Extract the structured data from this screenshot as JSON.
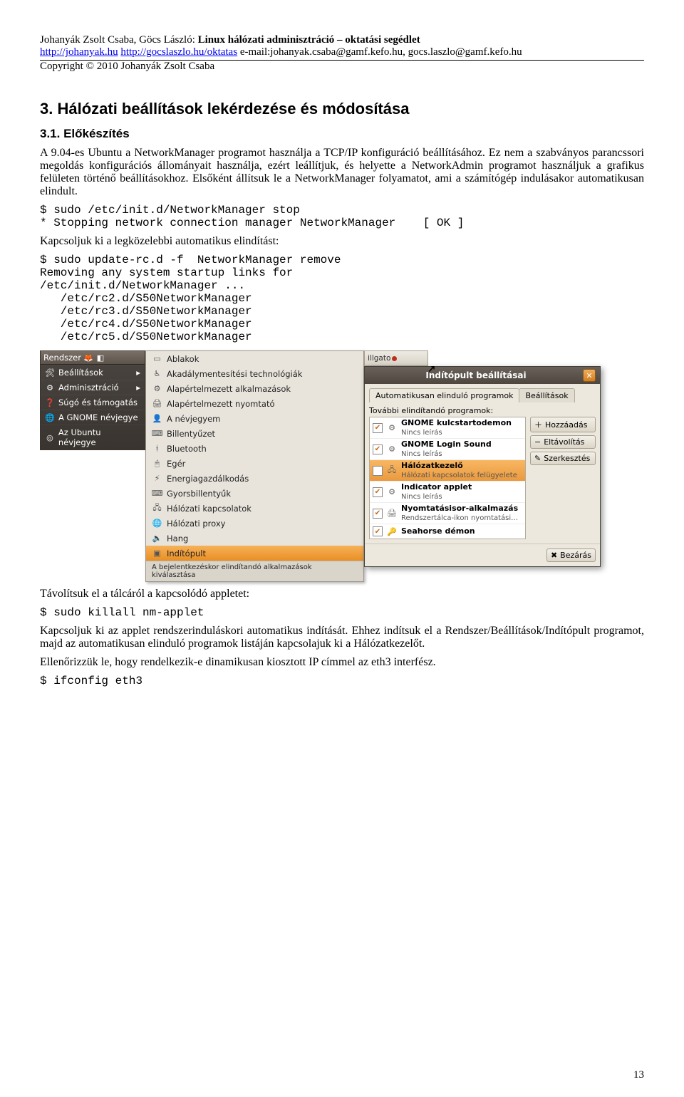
{
  "header": {
    "line1_before": "Johanyák Zsolt Csaba, Göcs László: ",
    "line1_bold": "Linux hálózati adminisztráció – oktatási segédlet",
    "link1": "http://johanyak.hu",
    "link2": "http://gocslaszlo.hu/oktatas",
    "line2_tail": " e-mail:johanyak.csaba@gamf.kefo.hu, gocs.laszlo@gamf.kefo.hu",
    "line3": "Copyright © 2010 Johanyák Zsolt Csaba"
  },
  "section": {
    "title": "3. Hálózati beállítások lekérdezése és módosítása",
    "sub1": "3.1. Előkészítés"
  },
  "paras": {
    "p1": "A 9.04-es Ubuntu a NetworkManager programot használja a TCP/IP konfiguráció beállításához. Ez nem a szabványos parancssori megoldás konfigurációs állományait használja, ezért leállítjuk, és helyette a NetworkAdmin programot használjuk a grafikus felületen történő beállításokhoz. Elsőként állítsuk le a NetworkManager folyamatot, ami a számítógép indulásakor automatikusan elindult.",
    "p2": "Kapcsoljuk ki a legközelebbi automatikus elindítást:",
    "p3": "Távolítsuk el a tálcáról a kapcsolódó appletet:",
    "p4": "Kapcsoljuk ki az applet rendszerinduláskori automatikus indítását. Ehhez indítsuk el a Rendszer/Beállítások/Indítópult programot, majd az automatikusan elinduló programok listáján kapcsolajuk ki a Hálózatkezelőt.",
    "p5": "Ellenőrizzük le, hogy rendelkezik-e dinamikusan kiosztott IP címmel az eth3 interfész."
  },
  "code": {
    "c1": "$ sudo /etc/init.d/NetworkManager stop\n* Stopping network connection manager NetworkManager    [ OK ]",
    "c2": "$ sudo update-rc.d -f  NetworkManager remove\nRemoving any system startup links for\n/etc/init.d/NetworkManager ...\n   /etc/rc2.d/S50NetworkManager\n   /etc/rc3.d/S50NetworkManager\n   /etc/rc4.d/S50NetworkManager\n   /etc/rc5.d/S50NetworkManager",
    "c3": "$ sudo killall nm-applet",
    "c4": "$ ifconfig eth3"
  },
  "sysmenu": {
    "top": "Rendszer",
    "items": [
      {
        "icon": "🛠",
        "label": "Beállítások",
        "arrow": "▸"
      },
      {
        "icon": "⚙",
        "label": "Adminisztráció",
        "arrow": "▸"
      },
      {
        "icon": "❓",
        "label": "Súgó és támogatás",
        "arrow": ""
      },
      {
        "icon": "🌐",
        "label": "A GNOME névjegye",
        "arrow": ""
      },
      {
        "icon": "◎",
        "label": "Az Ubuntu névjegye",
        "arrow": ""
      }
    ]
  },
  "submenu": {
    "items": [
      {
        "icon": "▭",
        "label": "Ablakok"
      },
      {
        "icon": "♿",
        "label": "Akadálymentesítési technológiák"
      },
      {
        "icon": "⚙",
        "label": "Alapértelmezett alkalmazások"
      },
      {
        "icon": "🖨",
        "label": "Alapértelmezett nyomtató"
      },
      {
        "icon": "👤",
        "label": "A névjegyem"
      },
      {
        "icon": "⌨",
        "label": "Billentyűzet"
      },
      {
        "icon": "ᚼ",
        "label": "Bluetooth"
      },
      {
        "icon": "🖱",
        "label": "Egér"
      },
      {
        "icon": "⚡",
        "label": "Energiagazdálkodás"
      },
      {
        "icon": "⌨",
        "label": "Gyorsbillentyűk"
      },
      {
        "icon": "🖧",
        "label": "Hálózati kapcsolatok"
      },
      {
        "icon": "🌐",
        "label": "Hálózati proxy"
      },
      {
        "icon": "🔈",
        "label": "Hang"
      },
      {
        "icon": "▣",
        "label": "Indítópult",
        "sel": true
      }
    ],
    "footer": "A bejelentkezéskor elindítandó alkalmazások kiválasztása"
  },
  "topbar": {
    "label": "illgato"
  },
  "dialog": {
    "title": "Indítópult beállításai",
    "tab1": "Automatikusan elinduló programok",
    "tab2": "Beállítások",
    "listlabel": "További elindítandó programok:",
    "rows": [
      {
        "chk": true,
        "title": "GNOME kulcstartodemon",
        "sub": "Nincs leírás"
      },
      {
        "chk": true,
        "title": "GNOME Login Sound",
        "sub": "Nincs leírás"
      },
      {
        "chk": false,
        "sel": true,
        "title": "Hálózatkezelő",
        "sub": "Hálózati kapcsolatok felügyelete"
      },
      {
        "chk": true,
        "title": "Indicator applet",
        "sub": "Nincs leírás"
      },
      {
        "chk": true,
        "title": "Nyomtatásisor-alkalmazás",
        "sub": "Rendszertálca-ikon nyomtatási…"
      },
      {
        "chk": true,
        "title": "Seahorse démon",
        "sub": ""
      }
    ],
    "btn_add": "Hozzáadás",
    "btn_remove": "Eltávolítás",
    "btn_edit": "Szerkesztés",
    "btn_close": "Bezárás"
  },
  "page_number": "13"
}
